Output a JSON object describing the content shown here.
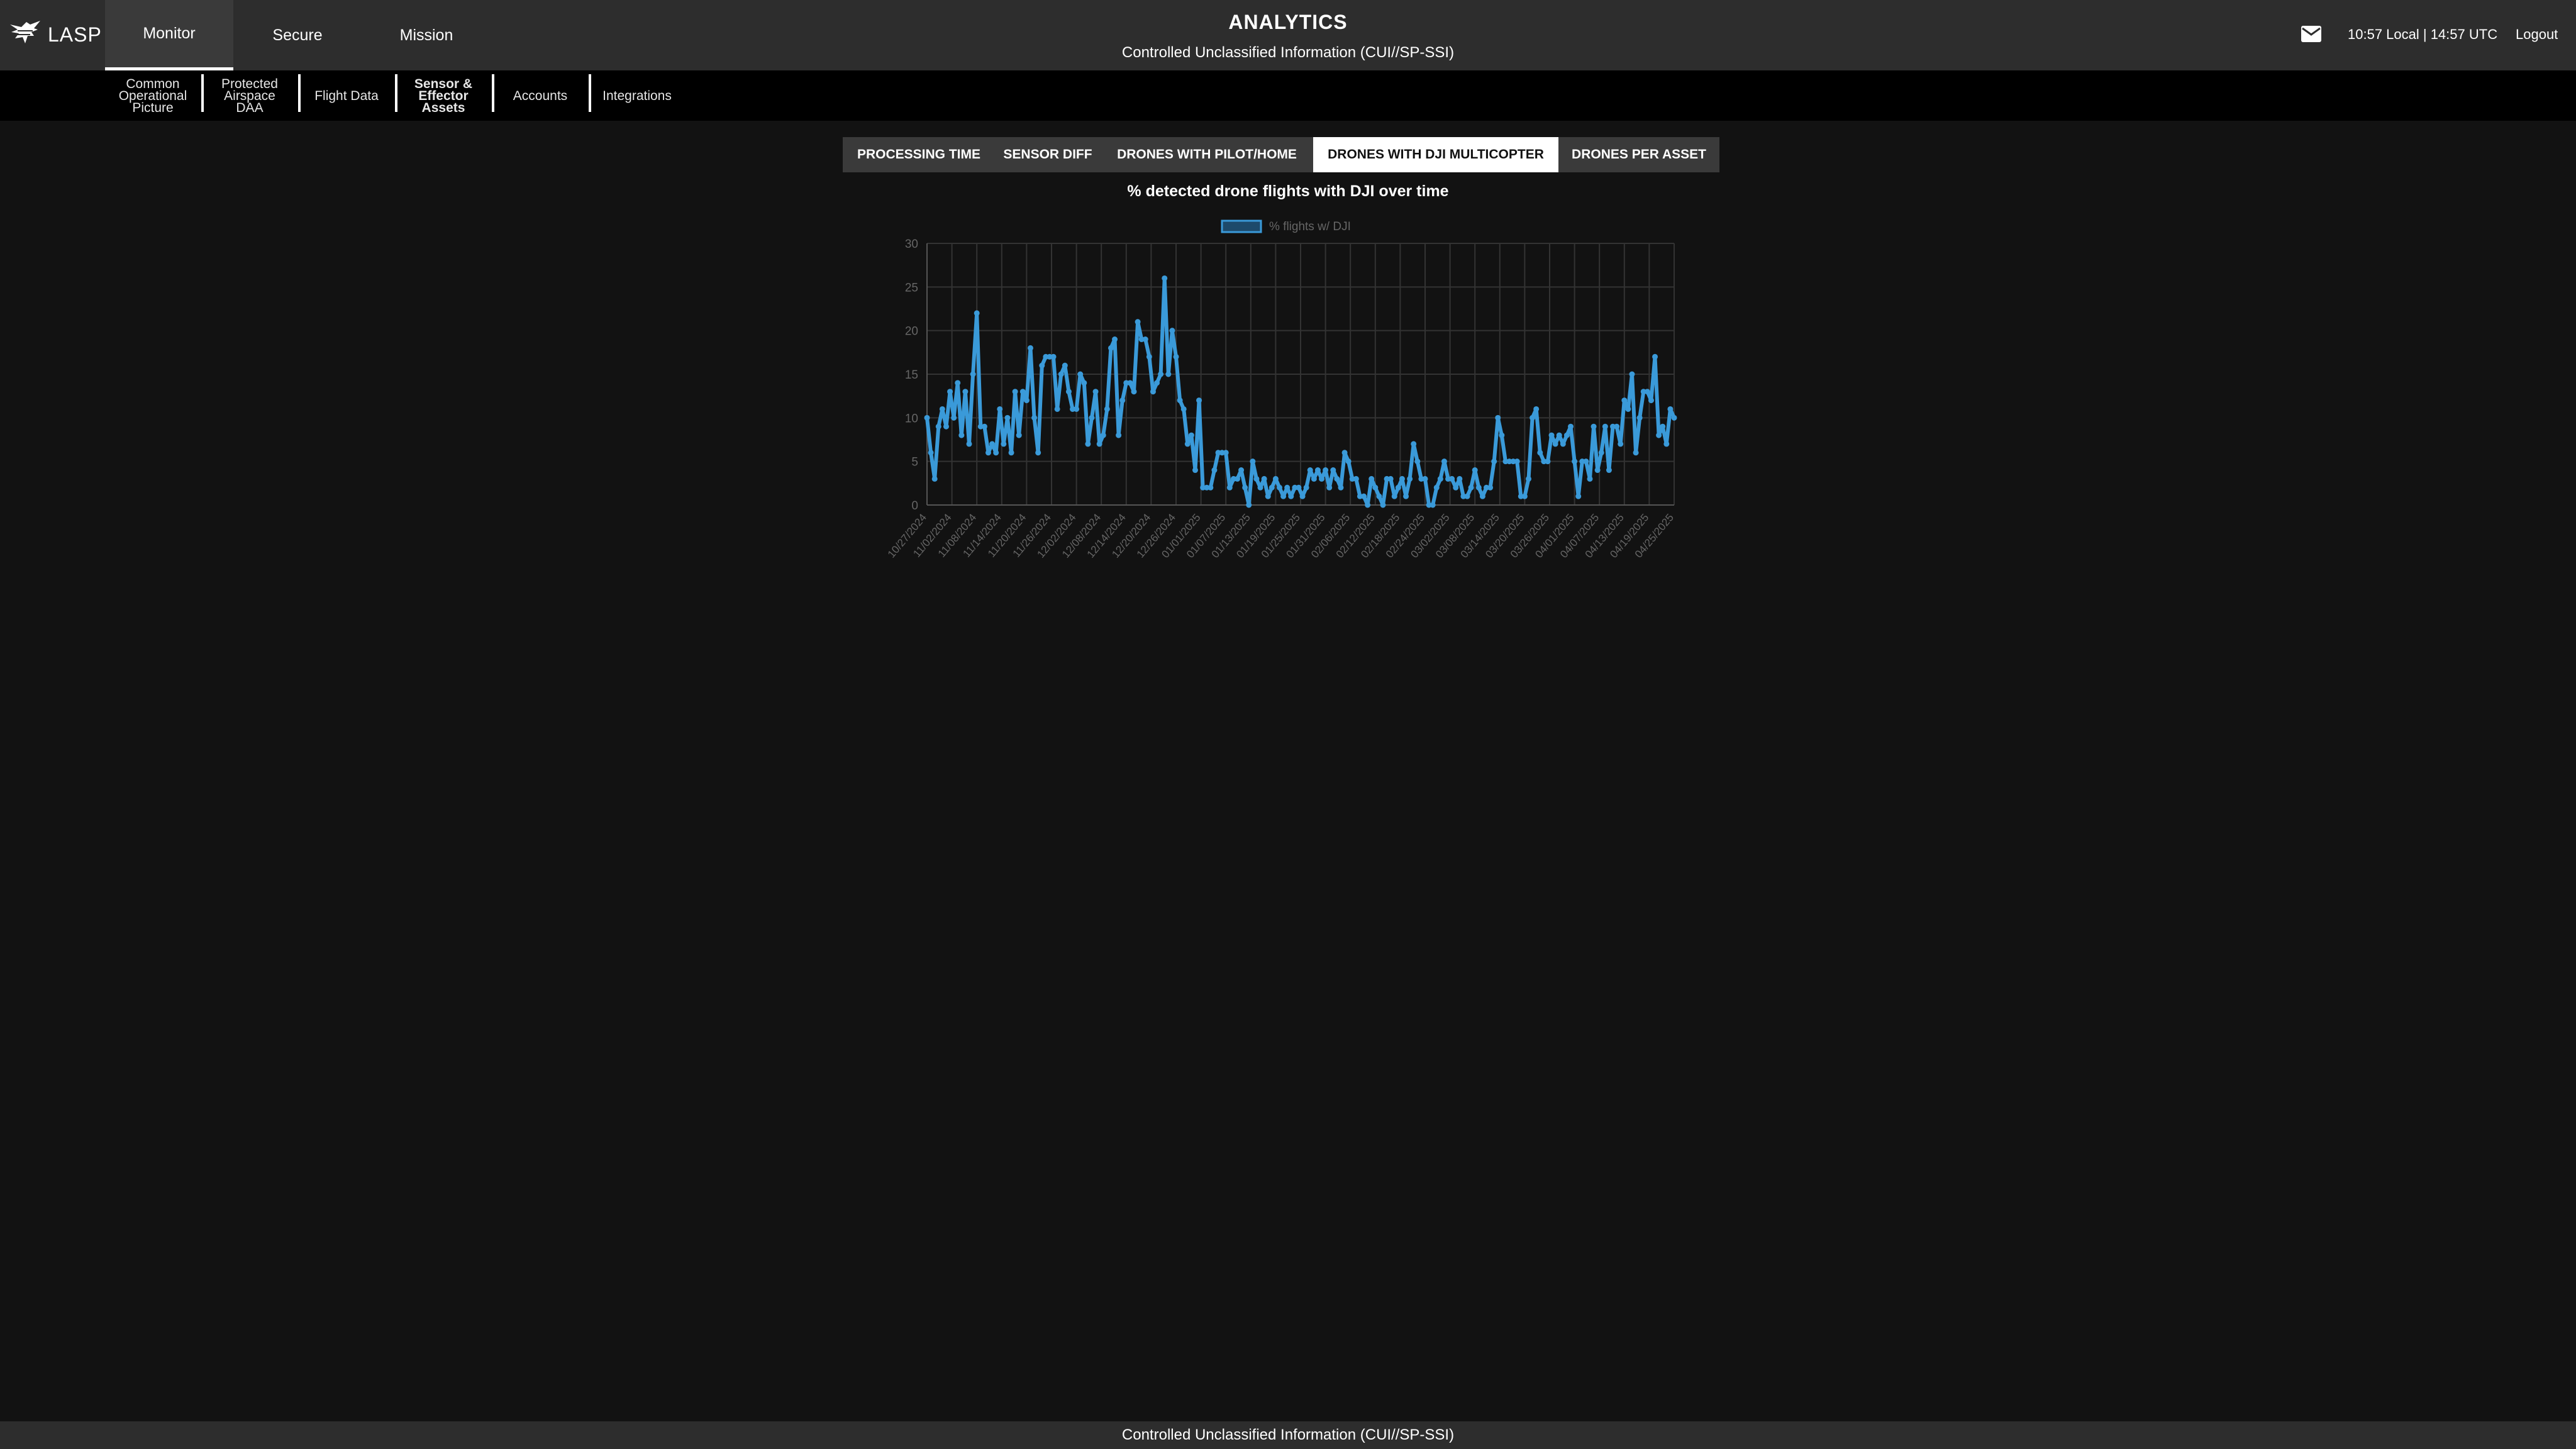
{
  "app": {
    "name": "LASP"
  },
  "nav": {
    "tabs": [
      "Monitor",
      "Secure",
      "Mission"
    ],
    "active": 0
  },
  "header": {
    "title": "ANALYTICS",
    "subtitle": "Controlled Unclassified Information (CUI//SP-SSI)"
  },
  "status": {
    "clock": "10:57 Local | 14:57 UTC",
    "logout": "Logout"
  },
  "subnav": {
    "items": [
      {
        "label": "Common\nOperational\nPicture"
      },
      {
        "label": "Protected\nAirspace\nDAA"
      },
      {
        "label": "Flight Data"
      },
      {
        "label": "Sensor &\nEffector\nAssets"
      },
      {
        "label": "Accounts"
      },
      {
        "label": "Integrations"
      }
    ]
  },
  "chart_tabs": {
    "items": [
      "PROCESSING TIME",
      "SENSOR DIFF",
      "DRONES WITH PILOT/HOME",
      "DRONES WITH DJI MULTICOPTER",
      "DRONES PER ASSET"
    ],
    "active": 3
  },
  "footer": {
    "text": "Controlled Unclassified Information (CUI//SP-SSI)"
  },
  "colors": {
    "line": "#3a9ad9",
    "topbar": "#2d2d2d",
    "background": "#121212"
  },
  "icons": {
    "mail": "mail-icon",
    "logo": "eagle-logo-icon"
  },
  "chart_data": {
    "type": "line",
    "title": "% detected drone flights with DJI over time",
    "legend": {
      "entries": [
        "% flights w/ DJI"
      ],
      "position": "top"
    },
    "ylim": [
      0,
      30
    ],
    "yticks": [
      0,
      5,
      10,
      15,
      20,
      25,
      30
    ],
    "xticks": [
      "10/27/2024",
      "11/02/2024",
      "11/08/2024",
      "11/14/2024",
      "11/20/2024",
      "11/26/2024",
      "12/02/2024",
      "12/08/2024",
      "12/14/2024",
      "12/20/2024",
      "12/26/2024",
      "01/01/2025",
      "01/07/2025",
      "01/13/2025",
      "01/19/2025",
      "01/25/2025",
      "01/31/2025",
      "02/06/2025",
      "02/12/2025",
      "02/18/2025",
      "02/24/2025",
      "03/02/2025",
      "03/08/2025",
      "03/14/2025",
      "03/20/2025",
      "03/26/2025",
      "04/01/2025",
      "04/07/2025",
      "04/13/2025",
      "04/19/2025",
      "04/25/2025"
    ],
    "grid": true,
    "series": [
      {
        "name": "% flights w/ DJI",
        "values": [
          10,
          6,
          3,
          9,
          11,
          9,
          13,
          10,
          14,
          8,
          13,
          7,
          15,
          22,
          9,
          9,
          6,
          7,
          6,
          11,
          7,
          10,
          6,
          13,
          8,
          13,
          12,
          18,
          10,
          6,
          16,
          17,
          17,
          17,
          11,
          15,
          16,
          13,
          11,
          11,
          15,
          14,
          7,
          10,
          13,
          7,
          8,
          11,
          18,
          19,
          8,
          12,
          14,
          14,
          13,
          21,
          19,
          19,
          17,
          13,
          14,
          15,
          26,
          15,
          20,
          17,
          12,
          11,
          7,
          8,
          4,
          12,
          2,
          2,
          2,
          4,
          6,
          6,
          6,
          2,
          3,
          3,
          4,
          2,
          0,
          5,
          3,
          2,
          3,
          1,
          2,
          3,
          2,
          1,
          2,
          1,
          2,
          2,
          1,
          2,
          4,
          3,
          4,
          3,
          4,
          2,
          4,
          3,
          2,
          6,
          5,
          3,
          3,
          1,
          1,
          0,
          3,
          2,
          1,
          0,
          3,
          3,
          1,
          2,
          3,
          1,
          3,
          7,
          5,
          3,
          3,
          0,
          0,
          2,
          3,
          5,
          3,
          3,
          2,
          3,
          1,
          1,
          2,
          4,
          2,
          1,
          2,
          2,
          5,
          10,
          8,
          5,
          5,
          5,
          5,
          1,
          1,
          3,
          10,
          11,
          6,
          5,
          5,
          8,
          7,
          8,
          7,
          8,
          9,
          5,
          1,
          5,
          5,
          3,
          9,
          4,
          6,
          9,
          4,
          9,
          9,
          7,
          12,
          11,
          15,
          6,
          10,
          13,
          13,
          12,
          17,
          8,
          9,
          7,
          11,
          10
        ]
      }
    ]
  }
}
